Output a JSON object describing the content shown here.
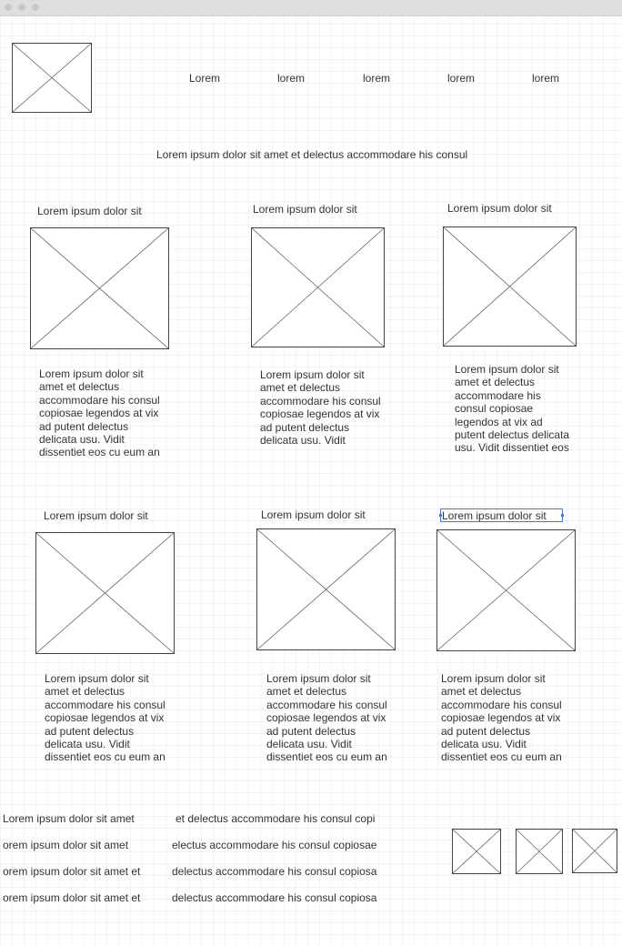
{
  "nav": {
    "items": [
      "Lorem",
      "lorem",
      "lorem",
      "lorem",
      "lorem"
    ]
  },
  "headline": "Lorem ipsum dolor sit amet et delectus accommodare his consul",
  "cards": [
    {
      "title": "Lorem ipsum dolor sit",
      "body": "Lorem ipsum dolor sit\namet et delectus\naccommodare his consul\ncopiosae legendos at vix\nad putent delectus\ndelicata usu. Vidit\ndissentiet eos cu eum an"
    },
    {
      "title": "Lorem ipsum dolor sit",
      "body": "Lorem ipsum dolor sit\namet et delectus\naccommodare his consul\ncopiosae legendos at vix\nad putent delectus\ndelicata usu. Vidit"
    },
    {
      "title": "Lorem ipsum dolor sit",
      "body": "Lorem ipsum dolor sit\namet et delectus\naccommodare his\nconsul copiosae\nlegendos at vix ad\nputent delectus delicata\nusu. Vidit dissentiet eos"
    },
    {
      "title": "Lorem ipsum dolor sit",
      "body": "Lorem ipsum dolor sit\namet et delectus\naccommodare his consul\ncopiosae legendos at vix\nad putent delectus\ndelicata usu. Vidit\ndissentiet eos cu eum an"
    },
    {
      "title": "Lorem ipsum dolor sit",
      "body": "Lorem ipsum dolor sit\namet et delectus\naccommodare his consul\ncopiosae legendos at vix\nad putent delectus\ndelicata usu. Vidit\ndissentiet eos cu eum an"
    },
    {
      "title": "Lorem ipsum dolor sit",
      "body": "Lorem ipsum dolor sit\namet et delectus\naccommodare his consul\ncopiosae legendos at vix\nad putent delectus\ndelicata usu. Vidit\ndissentiet eos cu eum an"
    }
  ],
  "footer": {
    "left": [
      "Lorem ipsum dolor sit amet",
      "orem ipsum dolor sit amet",
      "orem ipsum dolor sit amet et",
      "orem ipsum dolor sit amet et"
    ],
    "middle": [
      "et delectus accommodare his consul copi",
      "electus accommodare his consul copiosae",
      "delectus accommodare his consul copiosa",
      "delectus accommodare his consul copiosa"
    ]
  }
}
